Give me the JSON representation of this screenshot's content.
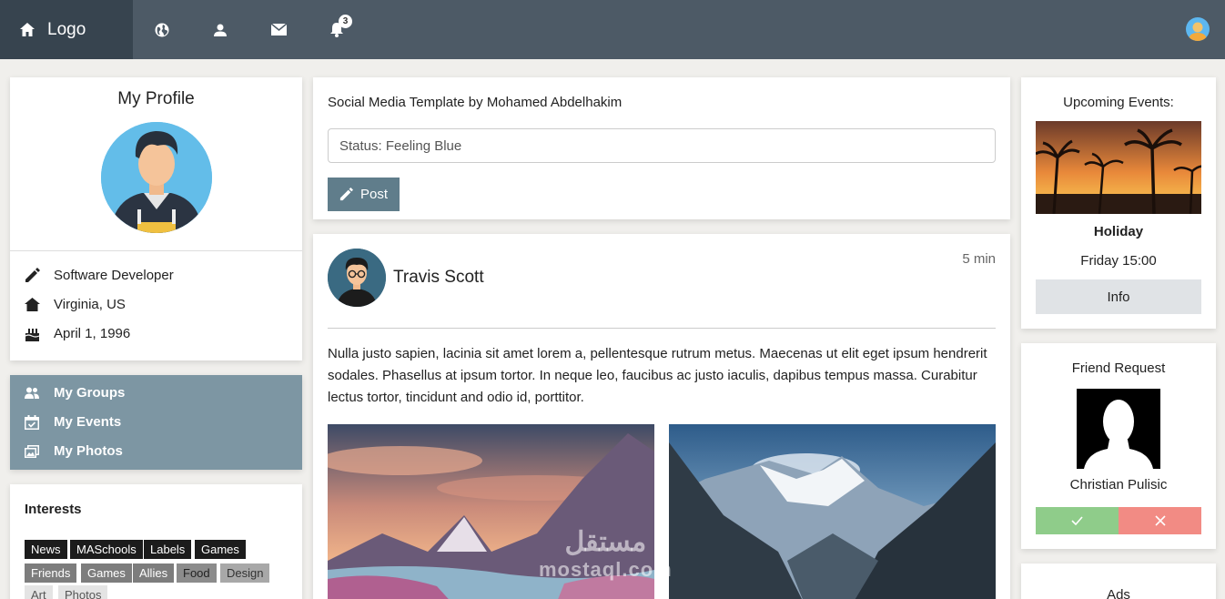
{
  "topbar": {
    "logo_label": "Logo",
    "notification_count": "3",
    "icons": [
      "home-icon",
      "globe-icon",
      "user-icon",
      "envelope-icon",
      "bell-icon"
    ],
    "background": "#4d5a66"
  },
  "profile": {
    "title": "My Profile",
    "job": "Software Developer",
    "location": "Virginia, US",
    "birthday": "April 1, 1996"
  },
  "menu": {
    "items": [
      {
        "label": "My Groups",
        "icon": "users-icon"
      },
      {
        "label": "My Events",
        "icon": "calendar-check-icon"
      },
      {
        "label": "My Photos",
        "icon": "photos-icon"
      }
    ],
    "background": "#7d96a3"
  },
  "interests": {
    "title": "Interests",
    "tags": [
      "News",
      "MASchools",
      "Labels",
      "Games",
      "Friends",
      "Games",
      "Allies",
      "Food",
      "Design",
      "Art",
      "Photos"
    ]
  },
  "status": {
    "title": "Social Media Template by Mohamed Abdelhakim",
    "input_value": "Status: Feeling Blue",
    "post_label": "Post"
  },
  "post": {
    "author": "Travis Scott",
    "time": "5 min",
    "text": "Nulla justo sapien, lacinia sit amet lorem a, pellentesque rutrum metus. Maecenas ut elit eget ipsum hendrerit sodales. Phasellus at ipsum tortor. In neque leo, faucibus ac justo iaculis, dapibus tempus massa. Curabitur lectus tortor, tincidunt and odio id, porttitor."
  },
  "events": {
    "title": "Upcoming Events:",
    "name": "Holiday",
    "time": "Friday 15:00",
    "info_label": "Info"
  },
  "friend_request": {
    "title": "Friend Request",
    "name": "Christian Pulisic",
    "accept_color": "#8fcc8a",
    "decline_color": "#f28b84"
  },
  "ads": {
    "title": "Ads"
  },
  "watermark": {
    "arabic": "مستقل",
    "latin": "mostaql.com"
  }
}
